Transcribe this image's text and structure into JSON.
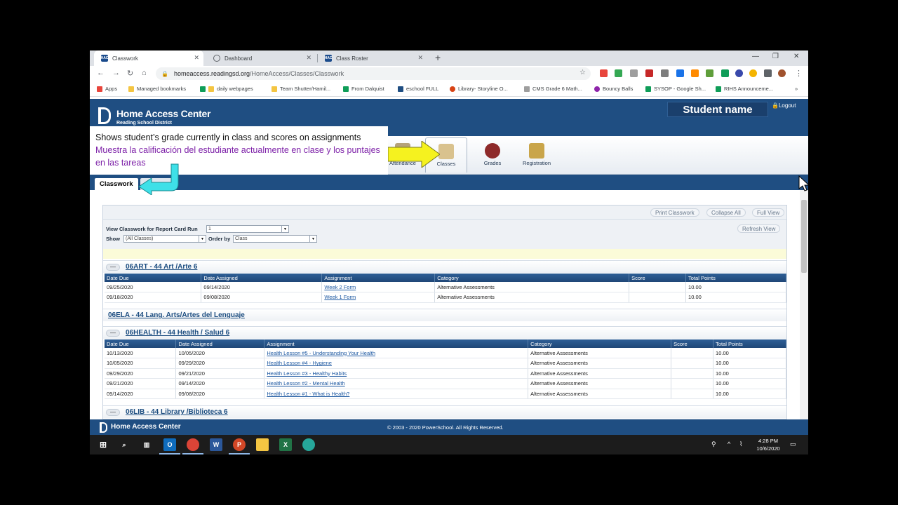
{
  "browser": {
    "tabs": [
      {
        "title": "Classwork",
        "icon": "HAC"
      },
      {
        "title": "Dashboard",
        "icon": "globe"
      },
      {
        "title": "Class Roster",
        "icon": "HAC"
      }
    ],
    "url_host": "homeaccess.readingsd.org",
    "url_path": "/HomeAccess/Classes/Classwork",
    "bookmarks": [
      "Apps",
      "Managed bookmarks",
      "daily webpages",
      "Team Shutter/Hamil...",
      "From Dalquist",
      "eschool FULL",
      "Library- Storyline O...",
      "CMS Grade 6 Math...",
      "Bouncy Balls",
      "SYSOP - Google Sh...",
      "RIHS Announceme..."
    ]
  },
  "header": {
    "title": "Home Access Center",
    "district": "Reading School District",
    "student_name": "Student name",
    "logout": "Logout"
  },
  "nav": [
    {
      "label": "Attendance",
      "color": "#b5a27a"
    },
    {
      "label": "Classes",
      "color": "#d9c28e"
    },
    {
      "label": "Grades",
      "color": "#8e2a2a"
    },
    {
      "label": "Registration",
      "color": "#c9a54a"
    }
  ],
  "page_tab": "Classwork",
  "annotation": {
    "english": "Shows student’s grade currently in class and scores on assignments",
    "spanish": "Muestra la calificación del estudiante actualmente en clase y los puntajes en las tareas"
  },
  "toolbar_buttons": {
    "print": "Print Classwork",
    "collapse": "Collapse All",
    "full": "Full View",
    "refresh": "Refresh View"
  },
  "filters": {
    "report_run_label": "View Classwork for Report Card Run",
    "report_run_value": "1",
    "show_label": "Show",
    "show_value": "(All Classes)",
    "order_label": "Order by",
    "order_value": "Class"
  },
  "columns": [
    "Date Due",
    "Date Assigned",
    "Assignment",
    "Category",
    "Score",
    "Total Points"
  ],
  "classes": [
    {
      "name": "06ART - 44 Art /Arte 6",
      "toggle": "—",
      "rows": [
        [
          "09/25/2020",
          "09/14/2020",
          "Week 2 Form",
          "Alternative Assessments",
          "",
          "10.00"
        ],
        [
          "09/18/2020",
          "09/08/2020",
          "Week 1 Form",
          "Alternative Assessments",
          "",
          "10.00"
        ]
      ]
    },
    {
      "name": "06ELA - 44 Lang. Arts/Artes del Lenguaje"
    },
    {
      "name": "06HEALTH - 44 Health / Salud 6",
      "toggle": "—",
      "rows": [
        [
          "10/13/2020",
          "10/05/2020",
          "Health Lesson #5 - Understanding Your Health",
          "Alternative Assessments",
          "",
          "10.00"
        ],
        [
          "10/05/2020",
          "09/29/2020",
          "Health Lesson #4 - Hygiene",
          "Alternative Assessments",
          "",
          "10.00"
        ],
        [
          "09/29/2020",
          "09/21/2020",
          "Health Lesson #3 - Healthy Habits",
          "Alternative Assessments",
          "",
          "10.00"
        ],
        [
          "09/21/2020",
          "09/14/2020",
          "Health Lesson #2 - Mental Health",
          "Alternative Assessments",
          "",
          "10.00"
        ],
        [
          "09/14/2020",
          "09/08/2020",
          "Health Lesson #1 - What is Health?",
          "Alternative Assessments",
          "",
          "10.00"
        ]
      ]
    },
    {
      "name": "06LIB - 44 Library /Biblioteca 6",
      "toggle": "—"
    }
  ],
  "footer": {
    "title": "Home Access Center",
    "copyright": "© 2003 - 2020 PowerSchool. All Rights Reserved."
  },
  "taskbar": {
    "time": "4:28 PM",
    "date": "10/6/2020"
  }
}
